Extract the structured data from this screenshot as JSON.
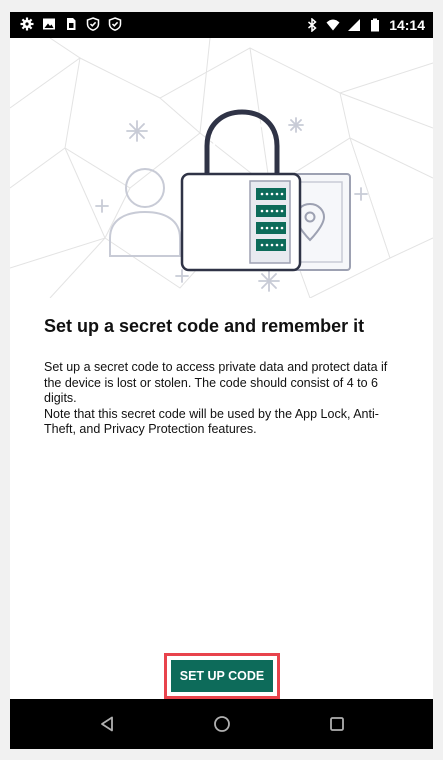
{
  "status_bar": {
    "time": "14:14",
    "left_icons": [
      "settings-icon",
      "image-icon",
      "sim-icon",
      "shield-check-icon",
      "shield-check-icon"
    ],
    "right_icons": [
      "bluetooth-icon",
      "wifi-icon",
      "signal-icon",
      "battery-icon"
    ]
  },
  "main": {
    "illustration": [
      "padlock-icon",
      "user-silhouette-icon",
      "location-pin-icon"
    ],
    "title": "Set up a secret code and remember it",
    "paragraph1": "Set up a secret code to access private data and protect data if the device is lost or stolen. The code should consist of 4 to 6 digits.",
    "paragraph2": "Note that this secret code will be used by the App Lock, Anti-Theft, and Privacy Protection features.",
    "button_label": "SET UP CODE"
  },
  "nav_bar": {
    "buttons": [
      "back-icon",
      "home-icon",
      "recents-icon"
    ]
  },
  "colors": {
    "accent": "#0d6b5a",
    "highlight": "#e8434c",
    "bars": "#000000"
  }
}
